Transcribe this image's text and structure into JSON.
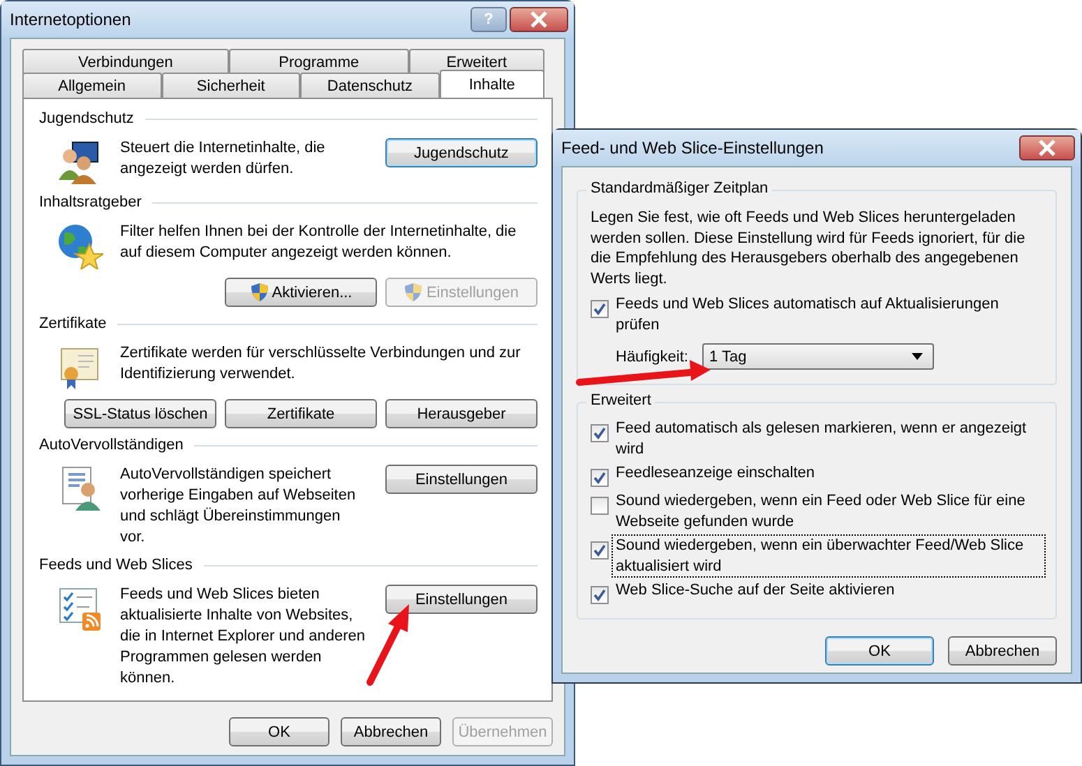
{
  "main_window": {
    "title": "Internetoptionen",
    "help_button": "?",
    "tab_rows": [
      [
        {
          "label": "Verbindungen",
          "selected": false
        },
        {
          "label": "Programme",
          "selected": false
        },
        {
          "label": "Erweitert",
          "selected": false
        }
      ],
      [
        {
          "label": "Allgemein",
          "selected": false
        },
        {
          "label": "Sicherheit",
          "selected": false
        },
        {
          "label": "Datenschutz",
          "selected": false
        },
        {
          "label": "Inhalte",
          "selected": true
        }
      ]
    ],
    "sections": [
      {
        "kind": "side",
        "title": "Jugendschutz",
        "description": "Steuert die Internetinhalte, die angezeigt werden dürfen.",
        "buttons": [
          {
            "label": "Jugendschutz",
            "shield": false,
            "disabled": false,
            "default": true
          }
        ]
      },
      {
        "kind": "below",
        "title": "Inhaltsratgeber",
        "description": "Filter helfen Ihnen bei der Kontrolle der Internetinhalte, die auf diesem Computer angezeigt werden können.",
        "buttons": [
          {
            "label": "Aktivieren...",
            "shield": true,
            "disabled": false,
            "default": false
          },
          {
            "label": "Einstellungen",
            "shield": true,
            "disabled": true,
            "default": false
          }
        ]
      },
      {
        "kind": "below",
        "title": "Zertifikate",
        "description": "Zertifikate werden für verschlüsselte Verbindungen und zur Identifizierung verwendet.",
        "buttons": [
          {
            "label": "SSL-Status löschen",
            "shield": false,
            "disabled": false,
            "default": false
          },
          {
            "label": "Zertifikate",
            "shield": false,
            "disabled": false,
            "default": false
          },
          {
            "label": "Herausgeber",
            "shield": false,
            "disabled": false,
            "default": false
          }
        ]
      },
      {
        "kind": "side",
        "title": "AutoVervollständigen",
        "description": "AutoVervollständigen speichert vorherige Eingaben auf Webseiten und schlägt Übereinstimmungen vor.",
        "buttons": [
          {
            "label": "Einstellungen",
            "shield": false,
            "disabled": false,
            "default": false
          }
        ]
      },
      {
        "kind": "side",
        "title": "Feeds und Web Slices",
        "description": "Feeds und Web Slices bieten aktualisierte Inhalte von Websites, die in Internet Explorer und anderen Programmen gelesen werden können.",
        "buttons": [
          {
            "label": "Einstellungen",
            "shield": false,
            "disabled": false,
            "default": false
          }
        ]
      }
    ],
    "buttons": [
      {
        "label": "OK",
        "disabled": false
      },
      {
        "label": "Abbrechen",
        "disabled": false
      },
      {
        "label": "Übernehmen",
        "disabled": true
      }
    ]
  },
  "dialog": {
    "title": "Feed- und Web Slice-Einstellungen",
    "schedule_group": {
      "title": "Standardmäßiger Zeitplan",
      "description": "Legen Sie fest, wie oft Feeds und Web Slices heruntergeladen werden sollen. Diese Einstellung wird für Feeds ignoriert, für die die Empfehlung des Herausgebers oberhalb des angegebenen Werts liegt.",
      "checkbox": {
        "label": "Feeds und Web Slices automatisch auf Aktualisierungen prüfen",
        "checked": true
      },
      "frequency_label": "Häufigkeit:",
      "frequency_value": "1 Tag"
    },
    "advanced_group": {
      "title": "Erweitert",
      "checkboxes": [
        {
          "label": "Feed automatisch als gelesen markieren, wenn er angezeigt wird",
          "checked": true,
          "focused": false
        },
        {
          "label": "Feedleseanzeige einschalten",
          "checked": true,
          "focused": false
        },
        {
          "label": "Sound wiedergeben, wenn ein Feed oder Web Slice für eine Webseite gefunden wurde",
          "checked": false,
          "focused": false
        },
        {
          "label": "Sound wiedergeben, wenn ein überwachter Feed/Web Slice aktualisiert wird",
          "checked": true,
          "focused": true
        },
        {
          "label": "Web Slice-Suche auf der Seite aktivieren",
          "checked": true,
          "focused": false
        }
      ]
    },
    "buttons": [
      {
        "label": "OK",
        "default": true
      },
      {
        "label": "Abbrechen",
        "default": false
      }
    ]
  }
}
